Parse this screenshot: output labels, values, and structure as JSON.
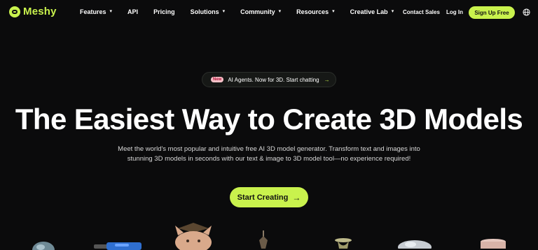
{
  "brand": {
    "name": "Meshy",
    "accent": "#c9f24d"
  },
  "nav": {
    "items": [
      {
        "label": "Features",
        "dropdown": true
      },
      {
        "label": "API",
        "dropdown": false
      },
      {
        "label": "Pricing",
        "dropdown": false
      },
      {
        "label": "Solutions",
        "dropdown": true
      },
      {
        "label": "Community",
        "dropdown": true
      },
      {
        "label": "Resources",
        "dropdown": true
      },
      {
        "label": "Creative Lab",
        "dropdown": true
      }
    ],
    "contact_sales": "Contact Sales",
    "login": "Log In",
    "signup": "Sign Up Free",
    "language_icon": "globe-icon"
  },
  "announcement": {
    "badge": "New",
    "text": "AI Agents. Now for 3D. Start chatting",
    "arrow": "→"
  },
  "hero": {
    "title": "The Easiest Way to Create 3D Models",
    "subtitle": "Meet the world's most popular and intuitive free AI 3D model generator. Transform text and images into stunning 3D models in seconds with our text & image to 3D model tool—no experience required!",
    "cta": "Start Creating",
    "cta_arrow": "→"
  },
  "showcase_models": [
    "globe-model",
    "drill-model",
    "cat-graduate-model",
    "figurine-model",
    "vase-model",
    "vehicle-model",
    "cake-model"
  ]
}
